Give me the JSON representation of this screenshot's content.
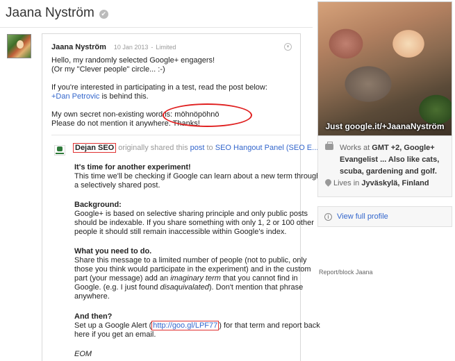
{
  "profile": {
    "name": "Jaana Nyström",
    "verified_glyph": "✔"
  },
  "post": {
    "author": "Jaana Nyström",
    "date": "10 Jan 2013",
    "separator": "-",
    "visibility": "Limited",
    "menu_icon": "chevron-down-icon",
    "lines": {
      "l1": "Hello, my randomly selected Google+ engagers!",
      "l2": "(Or my \"Clever people\" circle...  :-)",
      "l3": "If you're interested in participating in a test, read the post below:",
      "l4_link": "+Dan Petrovic",
      "l4_rest": " is behind this.",
      "l5": "My own secret non-existing word is: möhnöpöhnö",
      "l6": "Please do not mention it anywhere. Thanks!"
    }
  },
  "share": {
    "original_author": "Dejan SEO",
    "originally_shared": " originally shared this ",
    "post_link": "post",
    "to_text": " to ",
    "target": "SEO Hangout Panel (SEO E..."
  },
  "shared_post": {
    "h1": "It's time for another experiment!",
    "p1_1": "This time we'll be checking if Google can learn about a new term through",
    "p1_2": "a selectively shared post.",
    "h2": "Background:",
    "p2_1": "Google+ is based on selective sharing principle and only public posts",
    "p2_2": "should be indexable. If you share something with only 1, 2 or 100 other",
    "p2_3": "people it should still remain inaccessible within Google's index.",
    "h3": "What you need to do.",
    "p3_1": "Share this message to a limited number of people (not to public, only",
    "p3_2": "those you think would participate in the experiment) and in the custom",
    "p3_3a": "part (your message) add an ",
    "p3_3b": "imaginary term",
    "p3_3c": " that you cannot find in",
    "p3_4a": "Google. (e.g. I just found ",
    "p3_4b": "disaquivalated",
    "p3_4c": "). Don't mention that phrase",
    "p3_5": "anywhere.",
    "h4": "And then?",
    "p4_1a": "Set up a Google Alert (",
    "p4_1b": "http://goo.gl/LPF77",
    "p4_1c": ") for that term and report back",
    "p4_2": "here if you get an email.",
    "eom": "EOM"
  },
  "sidebar": {
    "photo_caption": "Just google.it/+JaanaNyström",
    "work_prefix": "Works at ",
    "work_line1": "GMT +2, Google+",
    "work_line2": "Evangelist ... Also like cats,",
    "work_line3": "scuba, gardening and golf.",
    "lives_prefix": "Lives in ",
    "lives_place": "Jyväskylä, Finland",
    "view_profile": "View full profile",
    "report": "Report/block Jaana"
  }
}
